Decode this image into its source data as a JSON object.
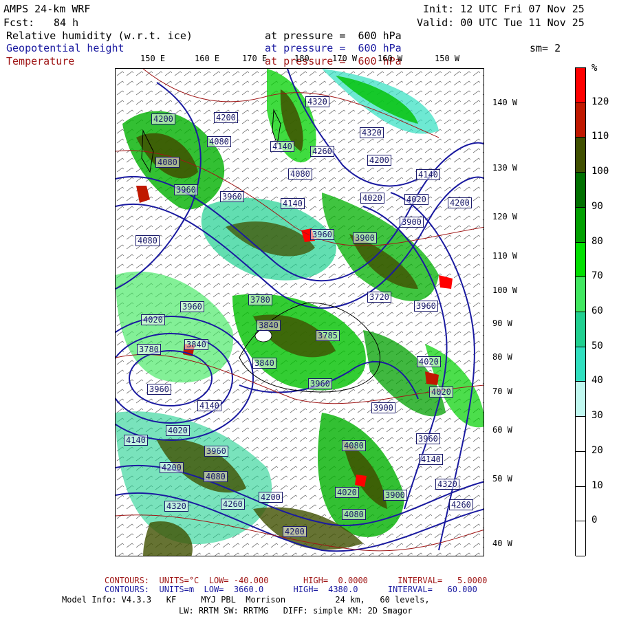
{
  "header": {
    "model": "AMPS 24-km WRF",
    "init": "Init: 12 UTC Fri 07 Nov 25",
    "fcst_label": "Fcst:",
    "fcst_value": "84 h",
    "valid": "Valid: 00 UTC Tue 11 Nov 25",
    "fields": [
      {
        "name": "Relative humidity (w.r.t. ice)",
        "level": "at pressure =  600 hPa",
        "color": "#000000"
      },
      {
        "name": "Geopotential height",
        "level": "at pressure =  600 hPa",
        "color": "#1a1aa0"
      },
      {
        "name": "Temperature",
        "level": "at pressure =  600 hPa",
        "color": "#a01818"
      }
    ],
    "smoothing": "sm= 2"
  },
  "longitude_labels": [
    "150 E",
    "160 E",
    "170 E",
    "180",
    "170 W",
    "160 W",
    "150 W"
  ],
  "latitude_labels": [
    "140 W",
    "130 W",
    "120 W",
    "110 W",
    "100 W",
    "90 W",
    "80 W",
    "70 W",
    "60 W",
    "50 W",
    "40 W"
  ],
  "colorbar": {
    "unit": "%",
    "labels": [
      "120",
      "110",
      "100",
      "90",
      "80",
      "70",
      "60",
      "50",
      "40",
      "30",
      "20",
      "10",
      "0"
    ],
    "segments": [
      {
        "color": "#ff0000"
      },
      {
        "color": "#c01800"
      },
      {
        "color": "#405000"
      },
      {
        "color": "#007000"
      },
      {
        "color": "#00a000"
      },
      {
        "color": "#00e000"
      },
      {
        "color": "#40e860"
      },
      {
        "color": "#20d090"
      },
      {
        "color": "#30e0c0"
      },
      {
        "color": "#c0f8f0"
      },
      {
        "color": "#ffffff"
      },
      {
        "color": "#ffffff"
      },
      {
        "color": "#ffffff"
      },
      {
        "color": "#ffffff"
      }
    ]
  },
  "height_labels": [
    "4200",
    "4200",
    "4320",
    "4320",
    "4140",
    "4080",
    "4200",
    "4260",
    "4140",
    "4080",
    "3960",
    "4080",
    "3900",
    "3960",
    "4020",
    "4020",
    "4140",
    "4200",
    "4080",
    "3900",
    "3960",
    "3780",
    "3720",
    "4020",
    "3960",
    "3840",
    "3785",
    "3960",
    "3840",
    "3780",
    "3840",
    "4020",
    "3960",
    "3960",
    "4020",
    "3900",
    "4140",
    "4140",
    "3960",
    "4020",
    "3960",
    "4080",
    "4200",
    "4320",
    "4140",
    "4080",
    "4200",
    "4260",
    "4020",
    "3900",
    "4080",
    "4200",
    "4260",
    "4320"
  ],
  "footer": {
    "temp_contours": "CONTOURS:  UNITS=°C  LOW= -40.000       HIGH=  0.0000      INTERVAL=   5.0000",
    "height_contours": "CONTOURS:  UNITS=m  LOW=  3660.0      HIGH=  4380.0      INTERVAL=   60.000",
    "model_info": "Model Info: V4.3.3   KF     MYJ PBL  Morrison          24 km,   60 levels,",
    "model_info2": "LW: RRTM SW: RRTMG   DIFF: simple KM: 2D Smagor"
  }
}
